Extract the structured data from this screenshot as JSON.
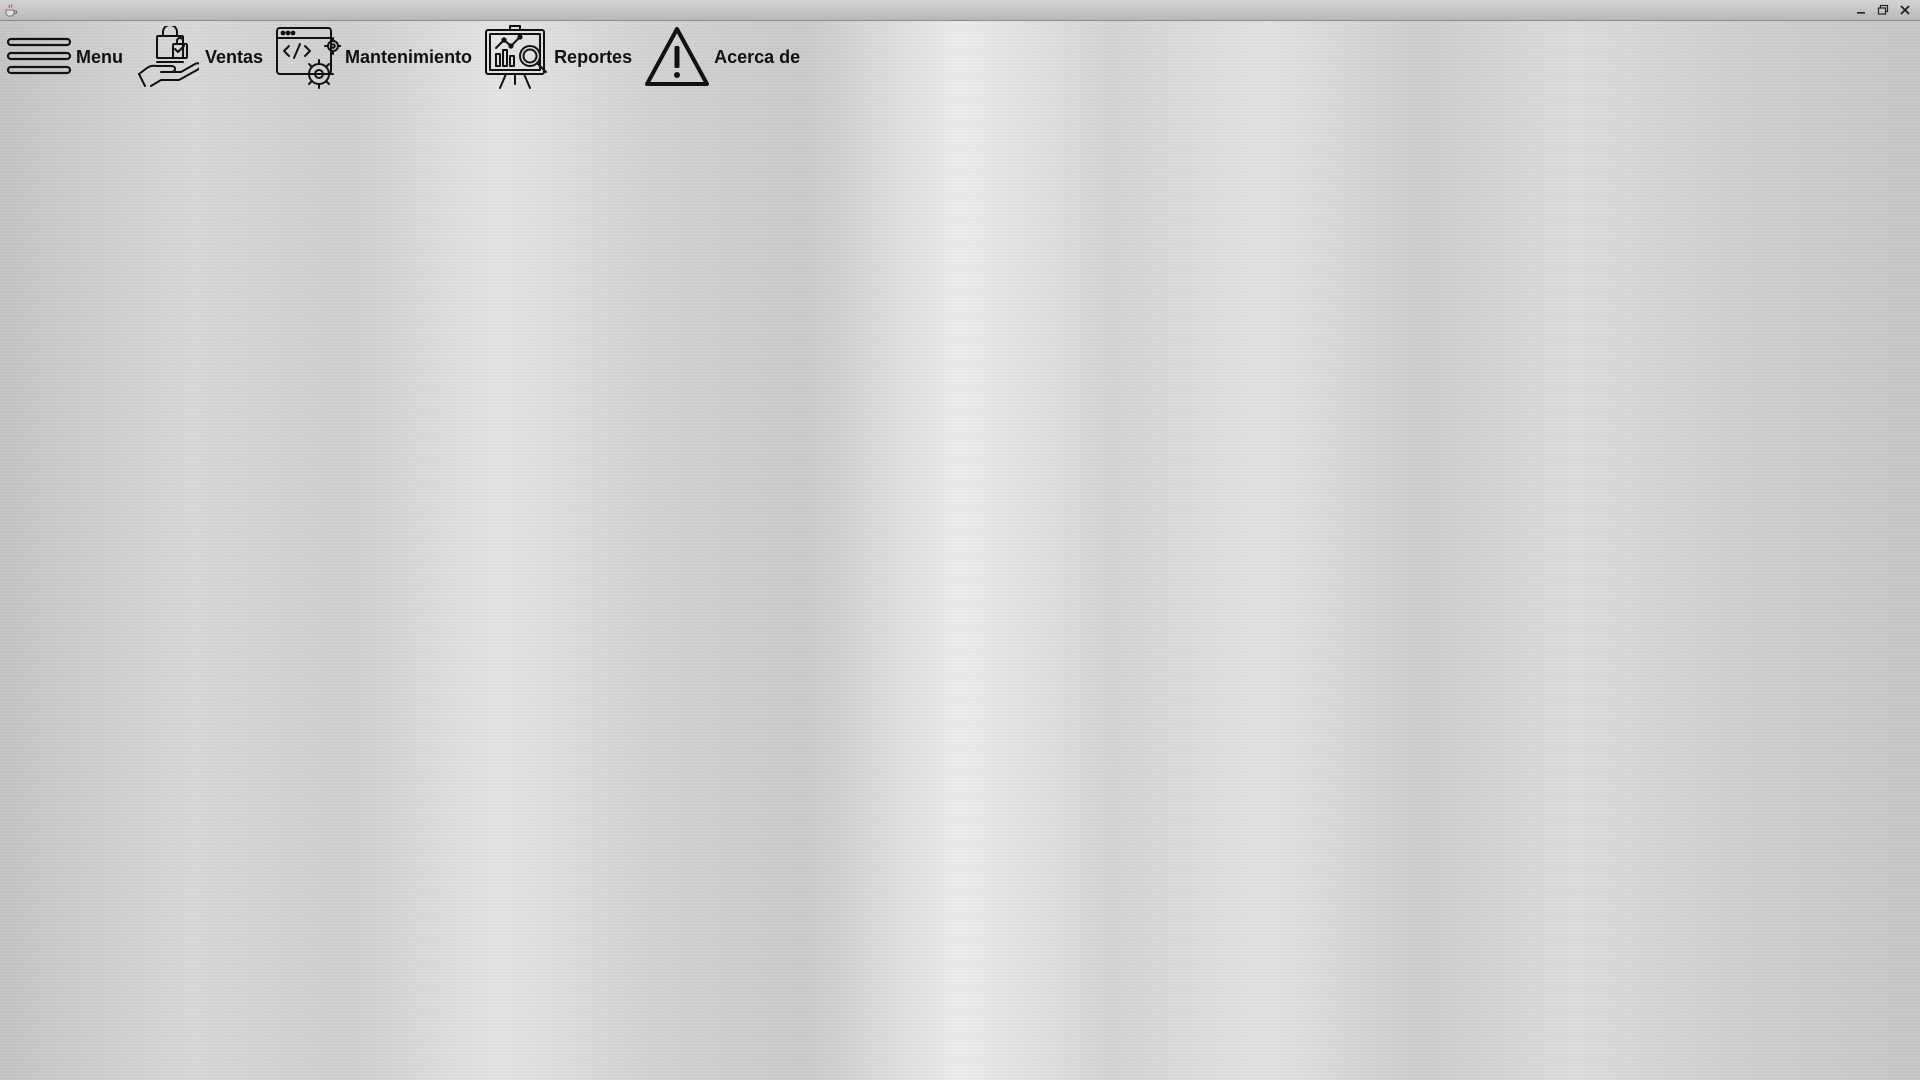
{
  "window": {
    "icon": "java-cup-icon",
    "controls": {
      "minimize": "minimize-icon",
      "maximize": "restore-icon",
      "close": "close-icon"
    }
  },
  "menubar": {
    "items": [
      {
        "label": "Menu",
        "icon": "hamburger-icon"
      },
      {
        "label": "Ventas",
        "icon": "shopping-bag-hand-icon"
      },
      {
        "label": "Mantenimiento",
        "icon": "code-window-gear-icon"
      },
      {
        "label": "Reportes",
        "icon": "chart-board-magnifier-icon"
      },
      {
        "label": "Acerca de",
        "icon": "warning-triangle-icon"
      }
    ]
  },
  "colors": {
    "text": "#111111",
    "icon_stroke": "#111111",
    "titlebar": "#c6c6c6"
  }
}
